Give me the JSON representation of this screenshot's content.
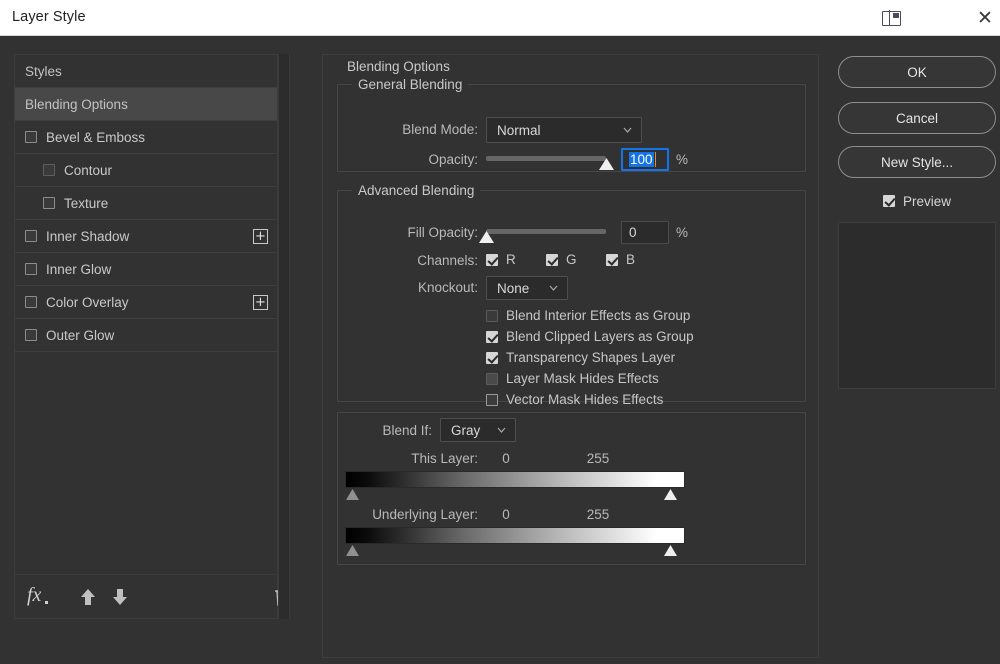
{
  "window": {
    "title": "Layer Style",
    "dock_icon": "panel-dock-icon",
    "close_icon": "close-icon"
  },
  "sidebar": {
    "items": [
      {
        "label": "Styles",
        "type": "header",
        "checkbox": null,
        "selected": false,
        "indent": false,
        "plus": false
      },
      {
        "label": "Blending Options",
        "type": "header",
        "checkbox": null,
        "selected": true,
        "indent": false,
        "plus": false
      },
      {
        "label": "Bevel & Emboss",
        "type": "effect",
        "checkbox": "unchecked",
        "selected": false,
        "indent": false,
        "plus": false
      },
      {
        "label": "Contour",
        "type": "effect",
        "checkbox": "disabled",
        "selected": false,
        "indent": true,
        "plus": false
      },
      {
        "label": "Texture",
        "type": "effect",
        "checkbox": "unchecked",
        "selected": false,
        "indent": true,
        "plus": false
      },
      {
        "label": "Inner Shadow",
        "type": "effect",
        "checkbox": "unchecked",
        "selected": false,
        "indent": false,
        "plus": true
      },
      {
        "label": "Inner Glow",
        "type": "effect",
        "checkbox": "unchecked",
        "selected": false,
        "indent": false,
        "plus": false
      },
      {
        "label": "Color Overlay",
        "type": "effect",
        "checkbox": "unchecked",
        "selected": false,
        "indent": false,
        "plus": true
      },
      {
        "label": "Outer Glow",
        "type": "effect",
        "checkbox": "unchecked",
        "selected": false,
        "indent": false,
        "plus": false
      }
    ],
    "plus_glyph": "+",
    "tools": {
      "fx_label": "fx",
      "move_up_icon": "arrow-up-icon",
      "move_down_icon": "arrow-down-icon",
      "delete_icon": "trash-icon"
    }
  },
  "main": {
    "panel_title": "Blending Options",
    "general": {
      "legend": "General Blending",
      "blend_mode_label": "Blend Mode:",
      "blend_mode_value": "Normal",
      "opacity_label": "Opacity:",
      "opacity_value": "100",
      "opacity_percent": 100,
      "percent_sign": "%"
    },
    "advanced": {
      "legend": "Advanced Blending",
      "fill_opacity_label": "Fill Opacity:",
      "fill_opacity_value": "0",
      "fill_opacity_percent": 0,
      "percent_sign": "%",
      "channels_label": "Channels:",
      "channels": [
        {
          "label": "R",
          "checked": true
        },
        {
          "label": "G",
          "checked": true
        },
        {
          "label": "B",
          "checked": true
        }
      ],
      "knockout_label": "Knockout:",
      "knockout_value": "None",
      "options": [
        {
          "label": "Blend Interior Effects as Group",
          "state": "dim-unchecked"
        },
        {
          "label": "Blend Clipped Layers as Group",
          "state": "checked"
        },
        {
          "label": "Transparency Shapes Layer",
          "state": "checked"
        },
        {
          "label": "Layer Mask Hides Effects",
          "state": "disabled"
        },
        {
          "label": "Vector Mask Hides Effects",
          "state": "unchecked"
        }
      ]
    },
    "blend_if": {
      "label": "Blend If:",
      "channel_value": "Gray",
      "this_layer": {
        "label": "This Layer:",
        "low": "0",
        "high": "255"
      },
      "underlying_layer": {
        "label": "Underlying Layer:",
        "low": "0",
        "high": "255"
      }
    }
  },
  "buttons": {
    "ok": "OK",
    "cancel": "Cancel",
    "new_style": "New Style...",
    "preview": "Preview",
    "preview_checked": true
  },
  "colors": {
    "panel_bg": "#323232",
    "titlebar_bg": "#ffffff",
    "selection_blue": "#1473e6",
    "row_selected": "#484848",
    "text": "#c9c9c9"
  }
}
